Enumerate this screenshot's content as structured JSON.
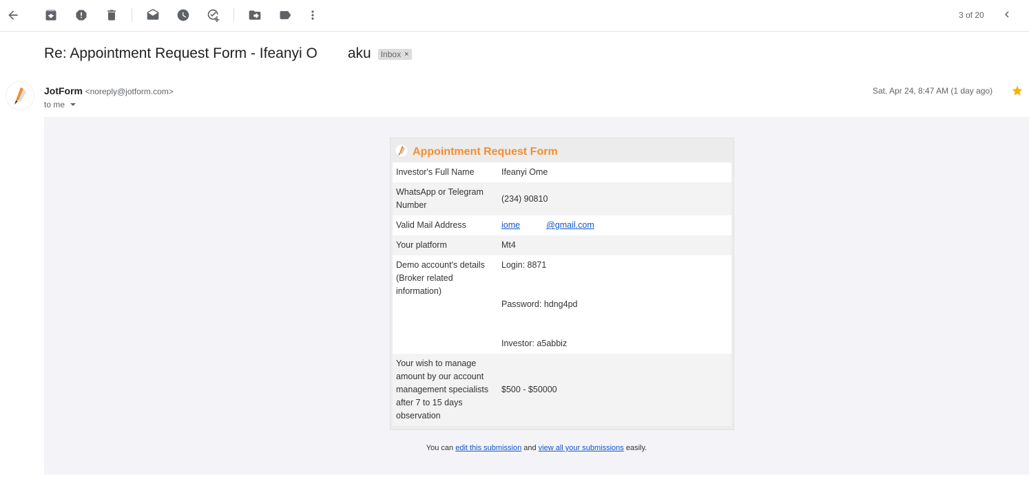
{
  "toolbar": {
    "buttons": [
      {
        "name": "back-button",
        "icon": "arrow-back-icon"
      },
      {
        "name": "archive-button",
        "icon": "archive-icon"
      },
      {
        "name": "report-spam-button",
        "icon": "report-icon"
      },
      {
        "name": "delete-button",
        "icon": "trash-icon"
      },
      {
        "name": "mark-unread-button",
        "icon": "mail-open-icon"
      },
      {
        "name": "snooze-button",
        "icon": "clock-icon"
      },
      {
        "name": "add-to-tasks-button",
        "icon": "task-add-icon"
      },
      {
        "name": "move-to-button",
        "icon": "move-icon"
      },
      {
        "name": "labels-button",
        "icon": "label-icon"
      },
      {
        "name": "more-button",
        "icon": "more-vert-icon"
      }
    ],
    "pager_text": "3 of 20"
  },
  "subject": {
    "title_prefix": "Re: Appointment Request Form - Ifeanyi O",
    "title_suffix": "aku",
    "label": "Inbox",
    "label_close": "×"
  },
  "message": {
    "sender_name": "JotForm",
    "sender_email": "<noreply@jotform.com>",
    "recipient": "to me",
    "date": "Sat, Apr 24, 8:47 AM (1 day ago)"
  },
  "form": {
    "title": "Appointment Request Form",
    "rows": [
      {
        "label": "Investor's Full Name",
        "value": "Ifeanyi Ome"
      },
      {
        "label": "WhatsApp or Telegram Number",
        "value": "(234) 90810"
      },
      {
        "label": "Valid Mail Address",
        "value_prefix": "iome",
        "value_suffix": "@gmail.com"
      },
      {
        "label": "Your platform",
        "value": "Mt4"
      },
      {
        "label": "Demo account's details (Broker related information)",
        "lines": [
          "Login: 8871",
          "Password: hdng4pd",
          "Investor: a5abbiz"
        ]
      },
      {
        "label": "Your wish to manage amount by our account management specialists after 7 to 15 days observation",
        "value": "$500 - $50000"
      }
    ]
  },
  "footer": {
    "prefix": "You can ",
    "edit_link": "edit this submission",
    "middle": " and ",
    "view_link": "view all your submissions",
    "suffix": " easily."
  },
  "colors": {
    "accent_orange": "#f28e30",
    "star": "#f4b400",
    "link": "#1155cc"
  }
}
